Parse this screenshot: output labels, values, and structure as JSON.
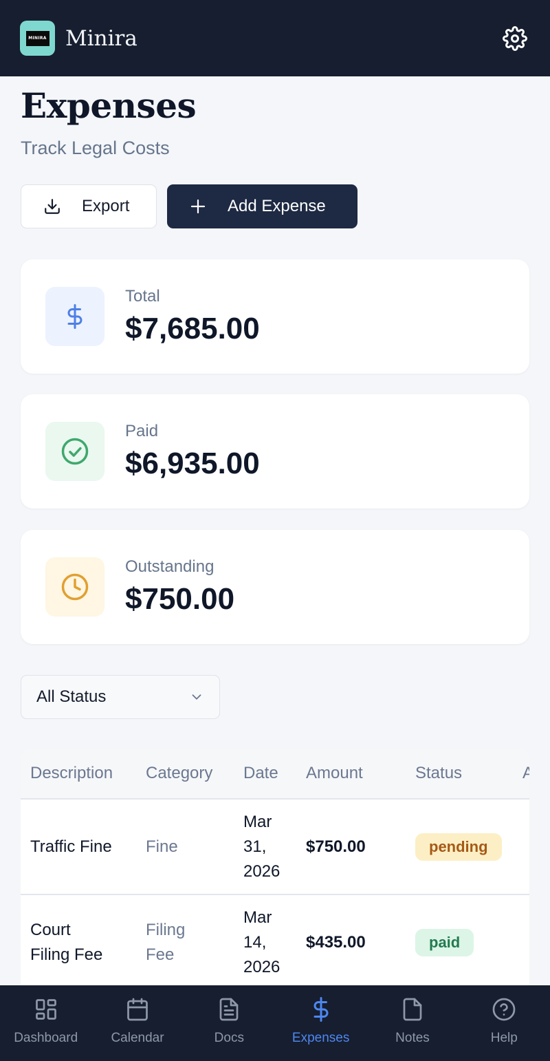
{
  "header": {
    "logo_text": "MINIRA",
    "app_name": "Minira",
    "settings_icon": "gear-icon"
  },
  "page": {
    "title": "Expenses",
    "subtitle": "Track Legal Costs"
  },
  "actions": {
    "export_label": "Export",
    "add_label": "Add Expense"
  },
  "summary": [
    {
      "label": "Total",
      "value": "$7,685.00",
      "icon": "dollar-icon",
      "color": "#4d7fe6",
      "bg": "#ecf2fe"
    },
    {
      "label": "Paid",
      "value": "$6,935.00",
      "icon": "check-circle-icon",
      "color": "#3fa86c",
      "bg": "#eaf8f0"
    },
    {
      "label": "Outstanding",
      "value": "$750.00",
      "icon": "clock-icon",
      "color": "#e0a030",
      "bg": "#fff6e3"
    }
  ],
  "filter": {
    "selected": "All Status"
  },
  "table": {
    "columns": [
      "Description",
      "Category",
      "Date",
      "Amount",
      "Status",
      "A"
    ],
    "rows": [
      {
        "description": [
          "Traffic Fine"
        ],
        "category": [
          "Fine"
        ],
        "date": [
          "Mar",
          "31,",
          "2026"
        ],
        "amount": "$750.00",
        "status": "pending"
      },
      {
        "description": [
          "Court",
          "Filing Fee"
        ],
        "category": [
          "Filing",
          "Fee"
        ],
        "date": [
          "Mar",
          "14,",
          "2026"
        ],
        "amount": "$435.00",
        "status": "paid"
      }
    ]
  },
  "nav": {
    "items": [
      {
        "label": "Dashboard",
        "icon": "dashboard-icon"
      },
      {
        "label": "Calendar",
        "icon": "calendar-icon"
      },
      {
        "label": "Docs",
        "icon": "document-icon"
      },
      {
        "label": "Expenses",
        "icon": "dollar-icon",
        "active": true
      },
      {
        "label": "Notes",
        "icon": "note-icon"
      },
      {
        "label": "Help",
        "icon": "help-icon"
      }
    ]
  }
}
